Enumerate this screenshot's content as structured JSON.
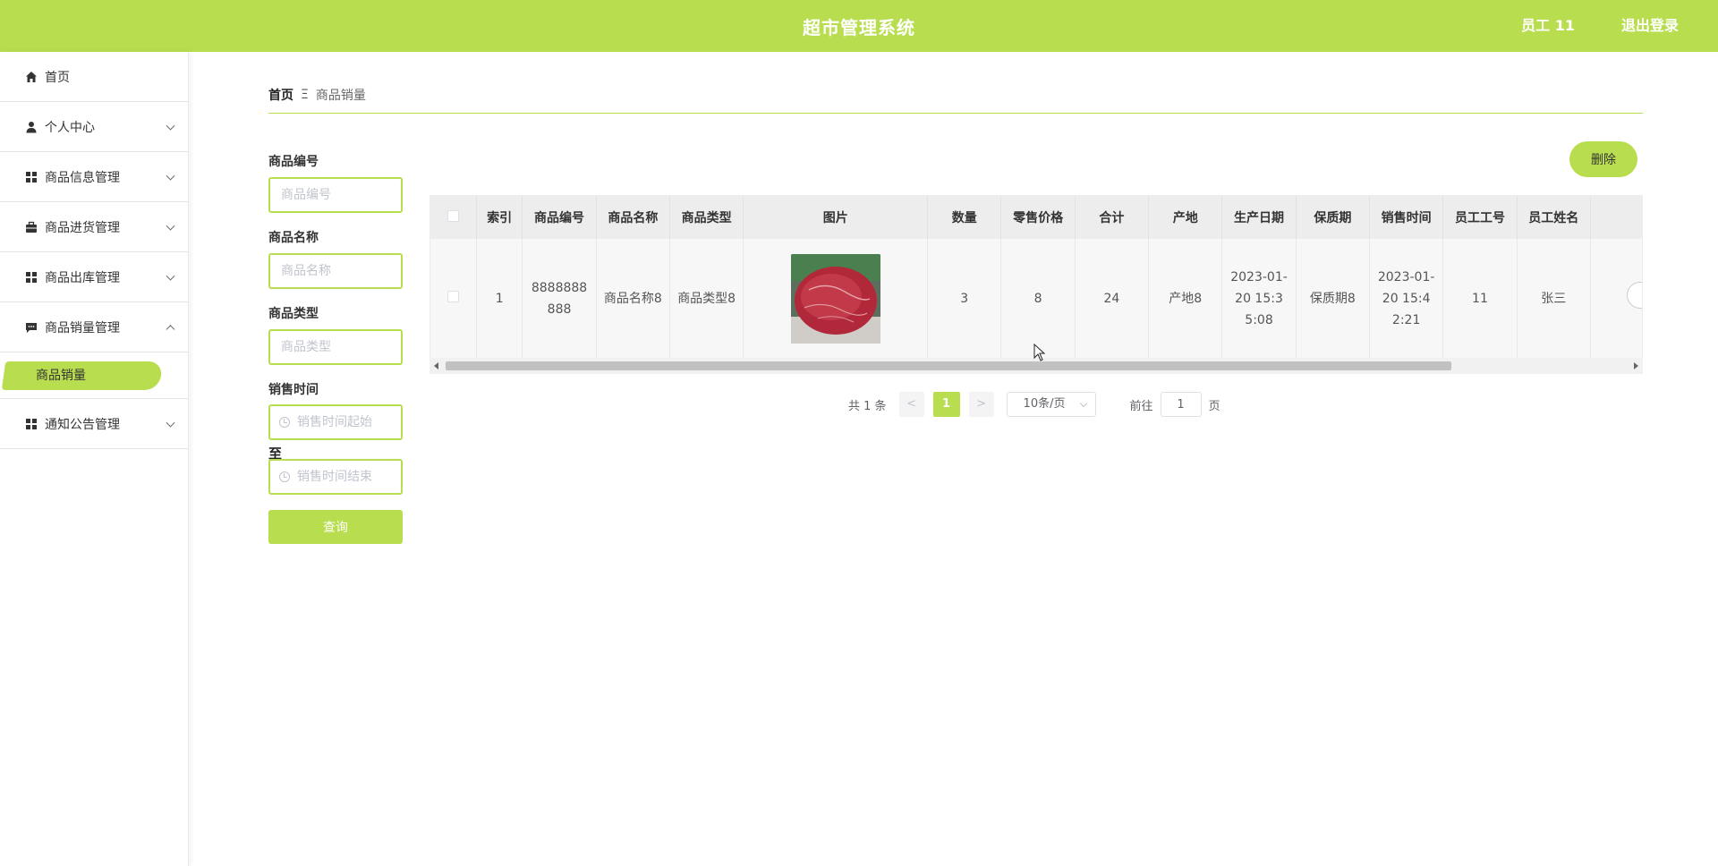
{
  "header": {
    "title": "超市管理系统",
    "user": "员工 11",
    "logout": "退出登录",
    "accent": "#b8dd4f"
  },
  "sidebar": {
    "items": [
      {
        "label": "首页",
        "icon": "home-icon"
      },
      {
        "label": "个人中心",
        "icon": "user-icon"
      },
      {
        "label": "商品信息管理",
        "icon": "grid-icon"
      },
      {
        "label": "商品进货管理",
        "icon": "briefcase-icon"
      },
      {
        "label": "商品出库管理",
        "icon": "grid-icon"
      },
      {
        "label": "商品销量管理",
        "icon": "chat-icon"
      },
      {
        "label": "通知公告管理",
        "icon": "grid-icon"
      }
    ],
    "sub_active": "商品销量"
  },
  "breadcrumb": {
    "home": "首页",
    "separator": "Ξ",
    "current": "商品销量"
  },
  "search": {
    "code_label": "商品编号",
    "code_placeholder": "商品编号",
    "name_label": "商品名称",
    "name_placeholder": "商品名称",
    "type_label": "商品类型",
    "type_placeholder": "商品类型",
    "time_label": "销售时间",
    "time_start_placeholder": "销售时间起始",
    "to_label": "至",
    "time_end_placeholder": "销售时间结束",
    "query_button": "查询"
  },
  "actions": {
    "delete_button": "删除"
  },
  "table": {
    "headers": [
      "索引",
      "商品编号",
      "商品名称",
      "商品类型",
      "图片",
      "数量",
      "零售价格",
      "合计",
      "产地",
      "生产日期",
      "保质期",
      "销售时间",
      "员工工号",
      "员工姓名"
    ],
    "rows": [
      {
        "index": "1",
        "code": "8888888888",
        "name": "商品名称8",
        "type": "商品类型8",
        "quantity": "3",
        "price": "8",
        "total": "24",
        "origin": "产地8",
        "production_date": "2023-01-20 15:35:08",
        "shelf_life": "保质期8",
        "sale_time": "2023-01-20 15:42:21",
        "staff_no": "11",
        "staff_name": "张三"
      }
    ]
  },
  "pagination": {
    "total": "共 1 条",
    "prev": "<",
    "page": "1",
    "next": ">",
    "page_size": "10条/页",
    "goto_prefix": "前往",
    "goto_value": "1",
    "goto_suffix": "页"
  }
}
